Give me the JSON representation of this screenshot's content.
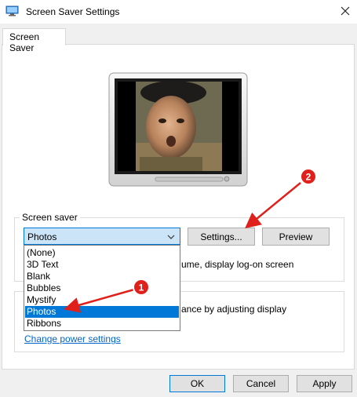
{
  "window": {
    "title": "Screen Saver Settings",
    "icon": "monitor-icon",
    "close_icon": "close-icon"
  },
  "tabs": [
    {
      "label": "Screen Saver",
      "active": true
    }
  ],
  "screen_saver": {
    "group_label": "Screen saver",
    "selected": "Photos",
    "options": [
      "(None)",
      "3D Text",
      "Blank",
      "Bubbles",
      "Mystify",
      "Photos",
      "Ribbons"
    ],
    "settings_label": "Settings...",
    "preview_label": "Preview",
    "resume_text": "ume, display log-on screen"
  },
  "power": {
    "text": "ance by adjusting display",
    "link": "Change power settings"
  },
  "buttons": {
    "ok": "OK",
    "cancel": "Cancel",
    "apply": "Apply"
  },
  "annotations": [
    {
      "number": "1",
      "color": "#e0201b"
    },
    {
      "number": "2",
      "color": "#e0201b"
    }
  ],
  "colors": {
    "accent": "#0078d7",
    "link": "#0066cc",
    "annotation": "#e0201b"
  }
}
